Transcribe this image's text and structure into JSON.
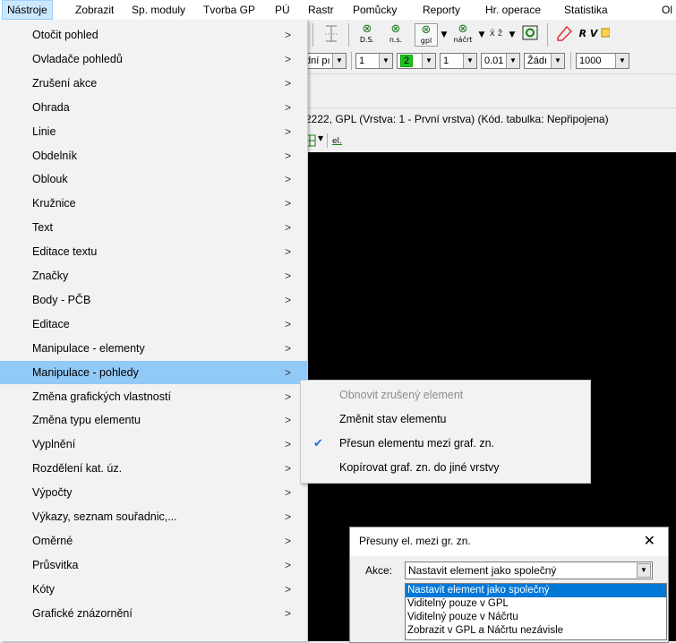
{
  "menubar": {
    "items": [
      "Nástroje",
      "Zobrazit",
      "Sp. moduly",
      "Tvorba GP",
      "PÚ",
      "Rastr",
      "Pomůcky",
      "Reporty",
      "Hr. operace",
      "Statistika",
      "Ol"
    ]
  },
  "toolbar": {
    "btn_ds": "D.S.",
    "btn_ns": "n.s.",
    "btn_gpl": "gpl",
    "btn_nacrt": "náčrt",
    "btn_rv": "R V",
    "combo_style": "dní pı",
    "combo_1": "1",
    "combo_2": "2",
    "combo_3": "1",
    "combo_4": "0.01",
    "combo_5": "Žádı",
    "combo_6": "1000",
    "btn_el": "el."
  },
  "window_title": "2222, GPL (Vrstva: 1 - První vrstva) (Kód. tabulka: Nepřipojena)",
  "menu": {
    "items": [
      "Otočit pohled",
      "Ovladače pohledů",
      "Zrušení akce",
      "Ohrada",
      "Linie",
      "Obdelník",
      "Oblouk",
      "Kružnice",
      "Text",
      "Editace textu",
      "Značky",
      "Body - PČB",
      "Editace",
      "Manipulace - elementy",
      "Manipulace - pohledy",
      "Změna grafických vlastností",
      "Změna typu elementu",
      "Vyplnění",
      "Rozdělení kat. úz.",
      "Výpočty",
      "Výkazy, seznam souřadnic,...",
      "Oměrné",
      "Průsvitka",
      "Kóty",
      "Grafické znázornění"
    ],
    "highlighted": "Manipulace - pohledy",
    "chevron": ">"
  },
  "submenu": {
    "items": [
      "Obnovit zrušený element",
      "Změnit stav elementu",
      "Přesun elementu mezi graf. zn.",
      "Kopírovat graf. zn. do jiné vrstvy"
    ],
    "disabled": "Obnovit zrušený element",
    "checked": "Přesun elementu mezi graf. zn."
  },
  "dialog": {
    "title": "Přesuny el. mezi gr. zn.",
    "label": "Akce:",
    "selected": "Nastavit element jako společný",
    "options": [
      "Nastavit element jako společný",
      "Viditelný pouze v GPL",
      "Viditelný pouze v Náčrtu",
      "Zobrazit v GPL a Náčrtu nezávisle"
    ]
  }
}
